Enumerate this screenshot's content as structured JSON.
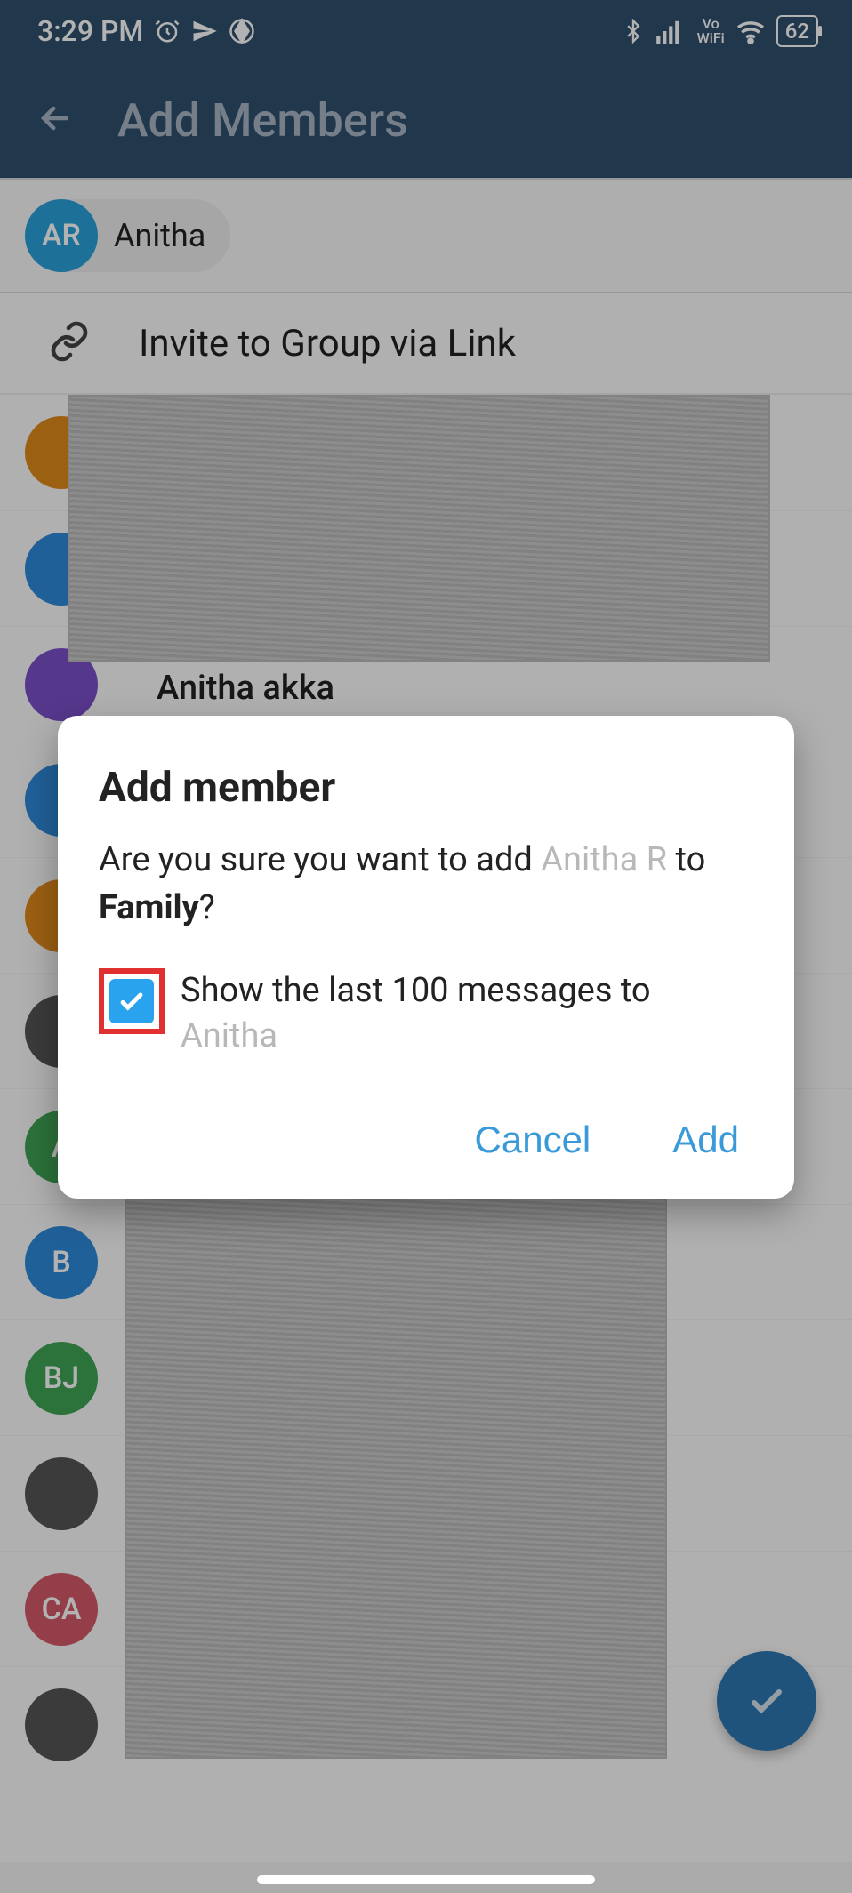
{
  "status": {
    "time": "3:29 PM",
    "vo_wifi_top": "Vo",
    "vo_wifi_bottom": "WiFi",
    "battery": "62"
  },
  "appbar": {
    "title": "Add Members"
  },
  "chip": {
    "initials": "AR",
    "name": "Anitha"
  },
  "invite": {
    "label": "Invite to Group via Link"
  },
  "fragment_name": "Anitha akka",
  "contacts": [
    {
      "initials": "A",
      "color": "av-g"
    },
    {
      "initials": "B",
      "color": "av-b"
    },
    {
      "initials": "BJ",
      "color": "av-g"
    },
    {
      "initials": "",
      "color": "av-img"
    },
    {
      "initials": "CA",
      "color": "av-r"
    },
    {
      "initials": "",
      "color": "av-img"
    }
  ],
  "dialog": {
    "title": "Add member",
    "q_prefix": "Are you sure you want to add ",
    "q_member": "Anitha R",
    "q_mid": " to ",
    "q_group": "Family",
    "q_suffix": "?",
    "checkbox_prefix": "Show the last 100 messages to ",
    "checkbox_name": "Anitha",
    "cancel": "Cancel",
    "add": "Add"
  }
}
